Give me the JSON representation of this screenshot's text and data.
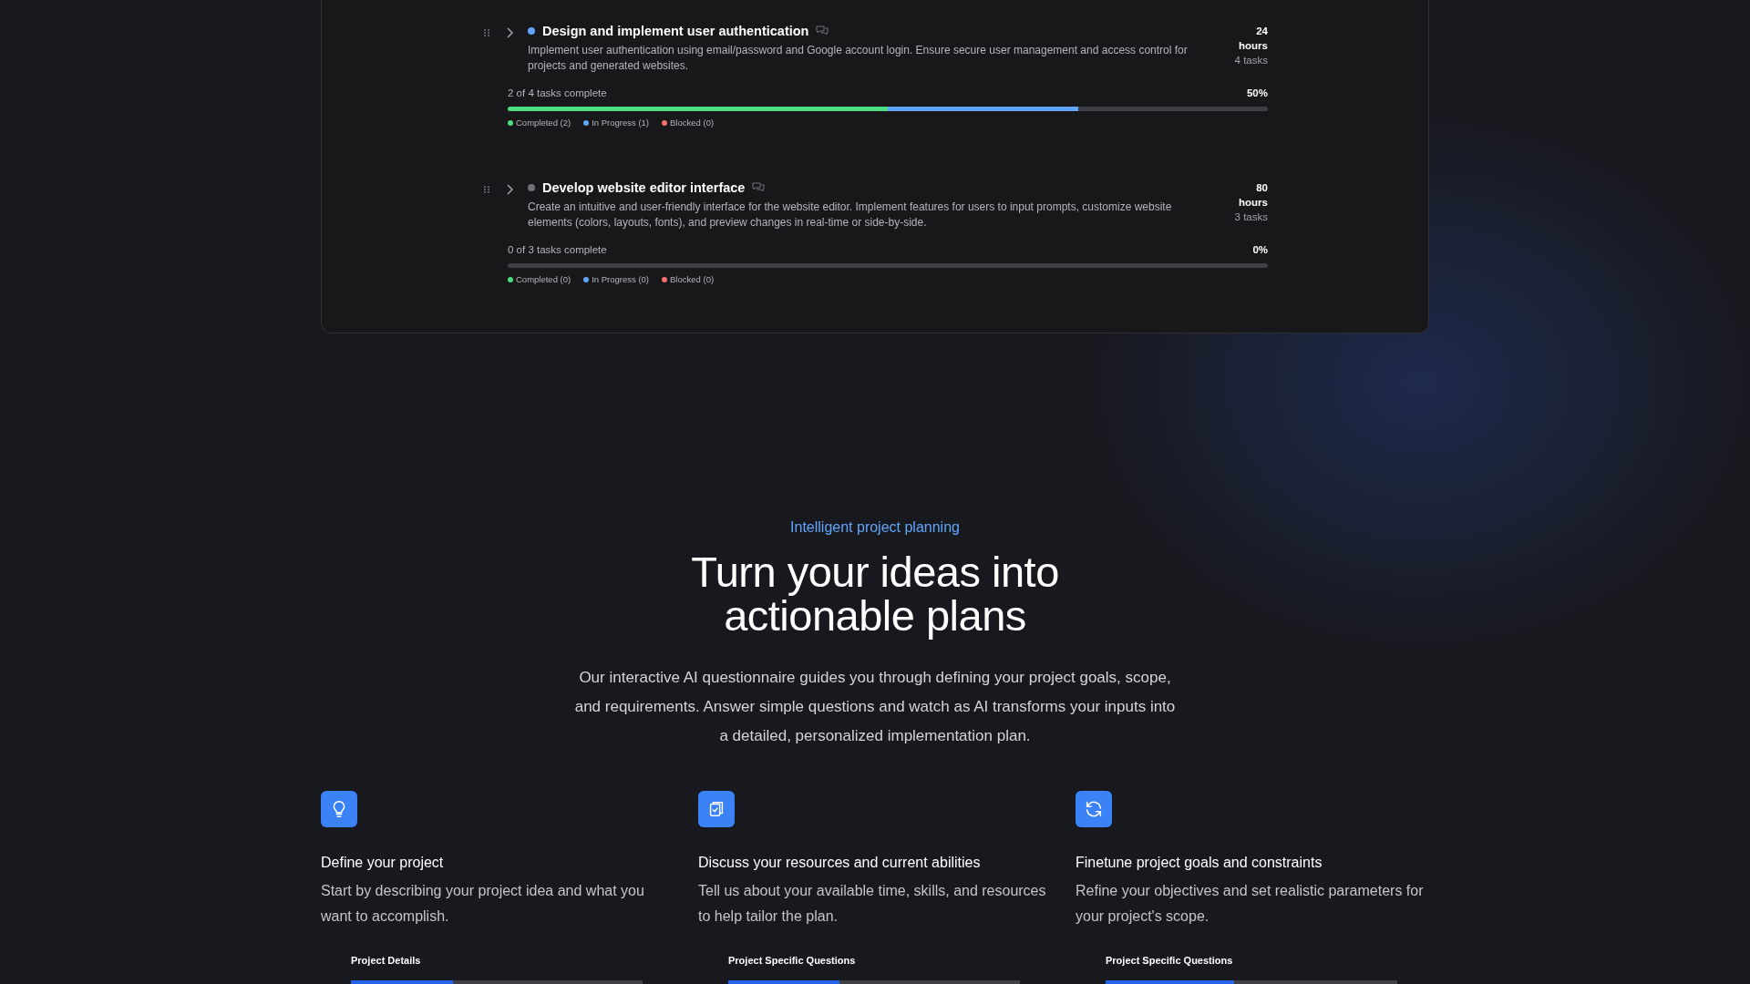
{
  "tasks": [
    {
      "title": "Design and implement user authentication",
      "color": "#60a5fa",
      "description": "Implement user authentication using email/password and Google account login. Ensure secure user management and access control for projects and generated websites.",
      "estimate": "24 hours",
      "task_count": "4 tasks",
      "progress_text": "2 of 4 tasks complete",
      "percent": "50%",
      "completed": {
        "level": 0.5
      },
      "in_progress": {
        "level": 0.75
      },
      "segments": [
        {
          "label": "Completed (2)",
          "color": "#4ade80"
        },
        {
          "label": "In Progress (1)",
          "color": "#60a5fa"
        },
        {
          "label": "Blocked (0)",
          "color": "#f87171"
        }
      ]
    },
    {
      "title": "Develop website editor interface",
      "color": "#71717a",
      "description": "Create an intuitive and user-friendly interface for the website editor. Implement features for users to input prompts, customize website elements (colors, layouts, fonts), and preview changes in real-time or side-by-side.",
      "estimate": "80 hours",
      "task_count": "3 tasks",
      "progress_text": "0 of 3 tasks complete",
      "percent": "0%",
      "completed": {
        "level": 0
      },
      "in_progress": {
        "level": 0
      },
      "segments": [
        {
          "label": "Completed (0)",
          "color": "#4ade80"
        },
        {
          "label": "In Progress (0)",
          "color": "#60a5fa"
        },
        {
          "label": "Blocked (0)",
          "color": "#f87171"
        }
      ]
    }
  ],
  "section": {
    "eyebrow": "Intelligent project planning",
    "headline": "Turn your ideas into actionable plans",
    "lead": "Our interactive AI questionnaire guides you through defining your project goals, scope, and requirements. Answer simple questions and watch as AI transforms your inputs into a detailed, personalized implementation plan."
  },
  "features": [
    {
      "kind": "bulb",
      "title": "Define your project",
      "description": "Start by describing your project idea and what you want to accomplish.",
      "preview": {
        "title": "Project Details",
        "level": 0.35
      }
    },
    {
      "kind": "clipboard",
      "title": "Discuss your resources and current abilities",
      "description": "Tell us about your available time, skills, and resources to help tailor the plan.",
      "preview": {
        "title": "Project Specific Questions",
        "level": 0.38
      }
    },
    {
      "kind": "refresh",
      "title": "Finetune project goals and constraints",
      "description": "Refine your objectives and set realistic parameters for your project's scope.",
      "preview": {
        "title": "Project Specific Questions",
        "level": 0.44
      }
    }
  ]
}
